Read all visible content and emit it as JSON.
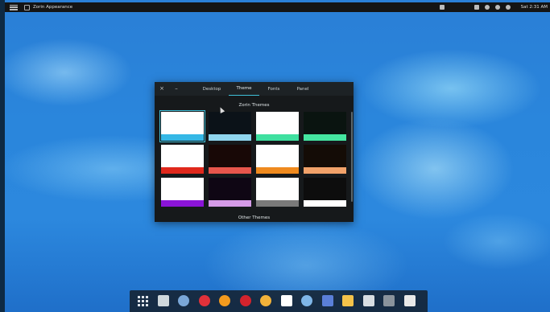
{
  "top_panel": {
    "app_name": "Zorin Appearance",
    "clock": "Sat 2:31 AM"
  },
  "dialog": {
    "close_glyph": "×",
    "minimize_glyph": "–",
    "tabs": [
      {
        "label": "Desktop",
        "active": false
      },
      {
        "label": "Theme",
        "active": true
      },
      {
        "label": "Fonts",
        "active": false
      },
      {
        "label": "Panel",
        "active": false
      }
    ],
    "section_zorin": "Zorin Themes",
    "section_other": "Other Themes",
    "themes": [
      {
        "name": "theme-light-blue",
        "body": "#ffffff",
        "bar": "#35b8e6",
        "selected": true
      },
      {
        "name": "theme-dark-blue",
        "body": "#0b1218",
        "bar": "#8fd5ee",
        "selected": false
      },
      {
        "name": "theme-light-green",
        "body": "#ffffff",
        "bar": "#3fe0a0",
        "selected": false
      },
      {
        "name": "theme-dark-green",
        "body": "#0a1410",
        "bar": "#44e6a0",
        "selected": false
      },
      {
        "name": "theme-light-red",
        "body": "#ffffff",
        "bar": "#e0281c",
        "selected": false
      },
      {
        "name": "theme-dark-red",
        "body": "#180806",
        "bar": "#e8564c",
        "selected": false
      },
      {
        "name": "theme-light-orange",
        "body": "#ffffff",
        "bar": "#ef8a1e",
        "selected": false
      },
      {
        "name": "theme-dark-orange",
        "body": "#140c06",
        "bar": "#f2a26a",
        "selected": false
      },
      {
        "name": "theme-light-purple",
        "body": "#ffffff",
        "bar": "#8b14d8",
        "selected": false
      },
      {
        "name": "theme-dark-purple",
        "body": "#0f0614",
        "bar": "#d59be8",
        "selected": false
      },
      {
        "name": "theme-light-grey",
        "body": "#ffffff",
        "bar": "#7a7a7a",
        "selected": false
      },
      {
        "name": "theme-dark-grey",
        "body": "#0d0d0d",
        "bar": "#ffffff",
        "selected": false
      }
    ]
  },
  "dock": {
    "items": [
      {
        "name": "apps-grid-icon",
        "color": "#dde3ea"
      },
      {
        "name": "file-manager-icon",
        "color": "#cfd8dc"
      },
      {
        "name": "chromium-icon",
        "color": "#7aa7d8"
      },
      {
        "name": "vivaldi-icon",
        "color": "#e0313a"
      },
      {
        "name": "firefox-icon",
        "color": "#f29a1e"
      },
      {
        "name": "record-icon",
        "color": "#d3232d"
      },
      {
        "name": "chat-icon",
        "color": "#f2b23a"
      },
      {
        "name": "document-icon",
        "color": "#ffffff"
      },
      {
        "name": "package-icon",
        "color": "#7fb6e8"
      },
      {
        "name": "send-icon",
        "color": "#5a7fd8"
      },
      {
        "name": "photos-icon",
        "color": "#f4c24a"
      },
      {
        "name": "terminal-icon",
        "color": "#d8dde2"
      },
      {
        "name": "display-icon",
        "color": "#8a939c"
      },
      {
        "name": "editor-icon",
        "color": "#e8e8e8"
      }
    ]
  }
}
